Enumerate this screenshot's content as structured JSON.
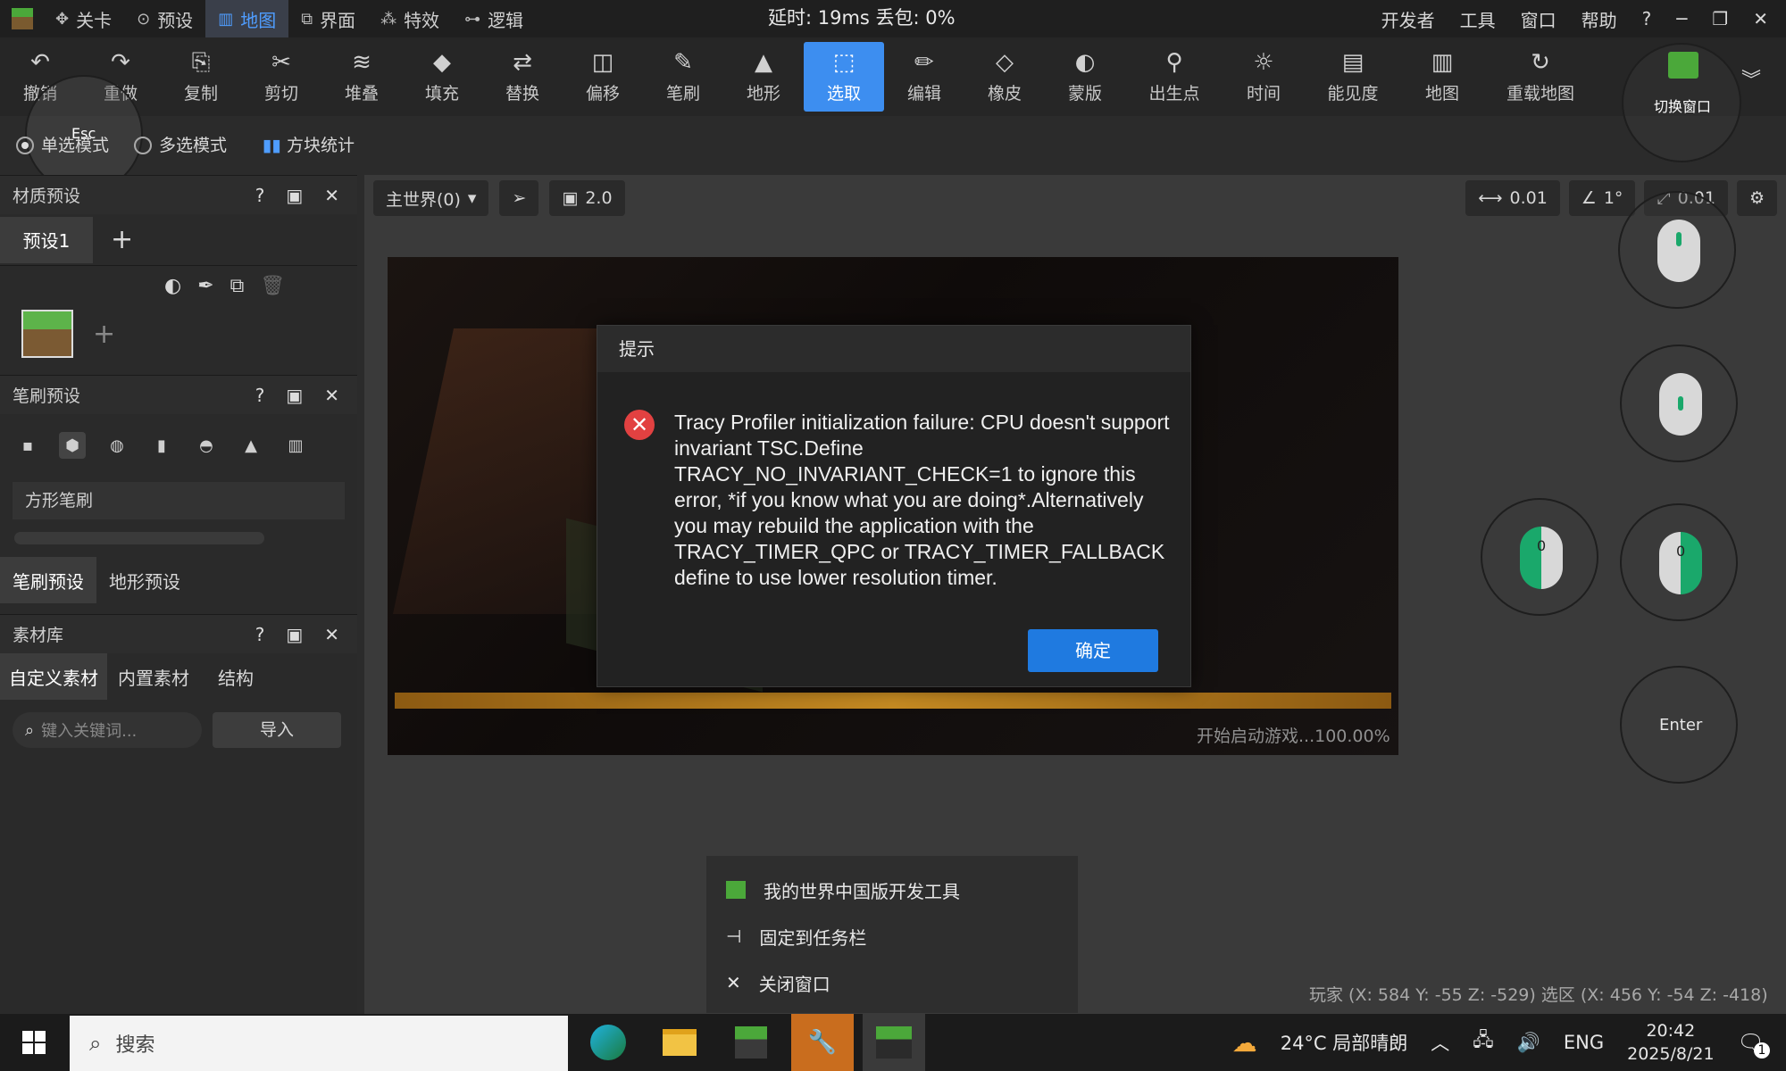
{
  "menu": {
    "tabs": [
      {
        "label": "关卡",
        "icon": "level-icon"
      },
      {
        "label": "预设",
        "icon": "preset-icon"
      },
      {
        "label": "地图",
        "icon": "map-icon"
      },
      {
        "label": "界面",
        "icon": "interface-icon"
      },
      {
        "label": "特效",
        "icon": "effects-icon"
      },
      {
        "label": "逻辑",
        "icon": "logic-icon"
      }
    ],
    "status": "延时: 19ms 丢包: 0%",
    "right": [
      "开发者",
      "工具",
      "窗口",
      "帮助",
      "?"
    ]
  },
  "toolbar": {
    "tools": [
      "撤销",
      "重做",
      "复制",
      "剪切",
      "堆叠",
      "填充",
      "替换",
      "偏移",
      "笔刷",
      "地形",
      "选取",
      "编辑",
      "橡皮",
      "蒙版",
      "出生点",
      "时间",
      "能见度",
      "地图",
      "重载地图"
    ],
    "active": "选取",
    "switch_window": "切换窗口"
  },
  "esc_label": "Esc",
  "subbar": {
    "single": "单选模式",
    "multi": "多选模式",
    "stats": "方块统计"
  },
  "panels": {
    "material": {
      "title": "材质预设",
      "tab": "预设1"
    },
    "brush": {
      "title": "笔刷预设",
      "field": "方形笔刷",
      "tab1": "笔刷预设",
      "tab2": "地形预设"
    },
    "library": {
      "title": "素材库",
      "tab1": "自定义素材",
      "tab2": "内置素材",
      "tab3": "结构",
      "search_placeholder": "键入关键词...",
      "import": "导入"
    }
  },
  "viewport": {
    "world": "主世界(0)",
    "speed": "2.0",
    "move_step": "0.01",
    "angle_step": "1°",
    "scale_step": "0.01",
    "progress_text": "开始启动游戏...100.00%",
    "progress": 1.0
  },
  "dialog": {
    "title": "提示",
    "message": "Tracy Profiler initialization failure: CPU doesn't support invariant TSC.Define TRACY_NO_INVARIANT_CHECK=1 to ignore this error, *if you know what you are doing*.Alternatively you may rebuild the application with the TRACY_TIMER_QPC or TRACY_TIMER_FALLBACK define to use lower resolution timer.",
    "ok": "确定"
  },
  "controls": {
    "enter": "Enter",
    "zero": "0"
  },
  "context_menu": [
    "我的世界中国版开发工具",
    "固定到任务栏",
    "关闭窗口"
  ],
  "coords": "玩家 (X: 584  Y: -55  Z: -529)  选区 (X: 456  Y: -54  Z: -418)",
  "taskbar": {
    "search": "搜索",
    "weather": "24°C  局部晴朗",
    "lang": "ENG",
    "time": "20:42",
    "date": "2025/8/21",
    "notif_count": "1"
  }
}
